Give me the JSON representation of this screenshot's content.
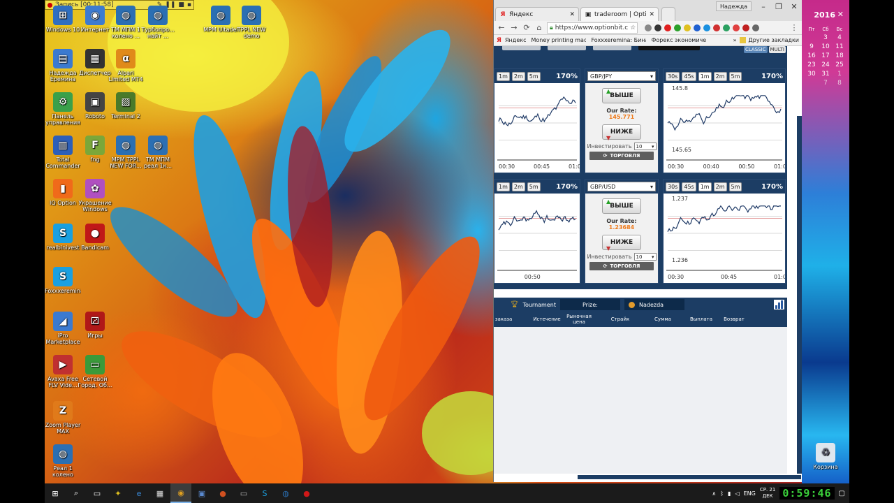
{
  "recording": {
    "label": "Запись [00:11:58]"
  },
  "desktop_icons": [
    {
      "label": "Windows 10",
      "color": "#2f6fc0",
      "glyph": "⊞",
      "col": 0,
      "row": 0
    },
    {
      "label": "Интернет",
      "color": "#3d7bd0",
      "glyph": "◉",
      "col": 1,
      "row": 0
    },
    {
      "label": "ТМ МПМ 1 колено ...",
      "color": "#2b6fb3",
      "glyph": "◍",
      "col": 2,
      "row": 0
    },
    {
      "label": "Турбопро... найт ...",
      "color": "#2b6fb3",
      "glyph": "◍",
      "col": 3,
      "row": 0
    },
    {
      "label": "МРМ Ultadel",
      "color": "#2b6fb3",
      "glyph": "◍",
      "col": 5,
      "row": 0
    },
    {
      "label": "ТРРL NEW demo",
      "color": "#2b6fb3",
      "glyph": "◍",
      "col": 6,
      "row": 0
    },
    {
      "label": "Надежда Еремина",
      "color": "#3b7ad0",
      "glyph": "▤",
      "col": 0,
      "row": 1
    },
    {
      "label": "Диспетчер",
      "color": "#333",
      "glyph": "▦",
      "col": 1,
      "row": 1
    },
    {
      "label": "Alpari Limited MT4",
      "color": "#e08a1a",
      "glyph": "α",
      "col": 2,
      "row": 1
    },
    {
      "label": "Панель управления",
      "color": "#3aa04a",
      "glyph": "⚙",
      "col": 0,
      "row": 2
    },
    {
      "label": "Roboto",
      "color": "#444",
      "glyph": "▣",
      "col": 1,
      "row": 2
    },
    {
      "label": "Terminal 2",
      "color": "#4a7a2a",
      "glyph": "▨",
      "col": 2,
      "row": 2
    },
    {
      "label": "Total Commander",
      "color": "#2d5fb8",
      "glyph": "▥",
      "col": 0,
      "row": 3
    },
    {
      "label": "fng",
      "color": "#7aa73a",
      "glyph": "F",
      "col": 1,
      "row": 3
    },
    {
      "label": "МРМ ТРРL NEW FOR...",
      "color": "#2b6fb3",
      "glyph": "◍",
      "col": 2,
      "row": 3
    },
    {
      "label": "ТМ МПМ реал 1к...",
      "color": "#2b6fb3",
      "glyph": "◍",
      "col": 3,
      "row": 3
    },
    {
      "label": "IQ Option",
      "color": "#f06a1a",
      "glyph": "▮",
      "col": 0,
      "row": 4
    },
    {
      "label": "Украшение Windows",
      "color": "#b050c0",
      "glyph": "✿",
      "col": 1,
      "row": 4
    },
    {
      "label": "realbinivest",
      "color": "#1aa0e0",
      "glyph": "S",
      "col": 0,
      "row": 5
    },
    {
      "label": "Bandicam",
      "color": "#c01818",
      "glyph": "●",
      "col": 1,
      "row": 5
    },
    {
      "label": "Foxxxeremina",
      "color": "#1aa0e0",
      "glyph": "S",
      "col": 0,
      "row": 6
    },
    {
      "label": "iPro Marketplace",
      "color": "#3b7ad0",
      "glyph": "◢",
      "col": 0,
      "row": 7
    },
    {
      "label": "Игры",
      "color": "#b01818",
      "glyph": "⚂",
      "col": 1,
      "row": 7
    },
    {
      "label": "Avaxa Free FLV Vide...",
      "color": "#c03030",
      "glyph": "▶",
      "col": 0,
      "row": 8
    },
    {
      "label": "Сетевой Город. Об...",
      "color": "#3a9a3a",
      "glyph": "▭",
      "col": 1,
      "row": 8
    },
    {
      "label": "Zoom Player MAX",
      "color": "#e07a1a",
      "glyph": "Z",
      "col": 0,
      "row": 9
    },
    {
      "label": "Реал 1 колено",
      "color": "#2b6fb3",
      "glyph": "◍",
      "col": 0,
      "row": 10
    }
  ],
  "recycle_bin": {
    "label": "Корзина"
  },
  "calendar": {
    "year": "2016",
    "close": "✕",
    "headers": [
      "Сб",
      "Вс"
    ],
    "rows": [
      [
        "3",
        "4"
      ],
      [
        "10",
        "11"
      ],
      [
        "17",
        "18"
      ],
      [
        "24",
        "25"
      ],
      [
        "31",
        "1"
      ],
      [
        "7",
        "8"
      ]
    ],
    "first_col": [
      "",
      "9",
      "16",
      "23",
      "30",
      ""
    ],
    "first_head": "Пт"
  },
  "browser": {
    "profile": "Надежда",
    "win_controls": [
      "–",
      "❐",
      "✕"
    ],
    "tabs": [
      {
        "title": "Яндекс",
        "icon": "Я",
        "icon_color": "#e02020"
      },
      {
        "title": "traderoom | OptionBit™",
        "icon": "▣",
        "icon_color": "#222"
      }
    ],
    "nav": [
      "←",
      "→",
      "⟳",
      "⌂"
    ],
    "url": "https://www.optionbit.c",
    "bookmarks": [
      {
        "label": "Яндекс",
        "color": "#e02020"
      },
      {
        "label": "Money printing mach",
        "color": "#888"
      },
      {
        "label": "Foxxxeremina: Бинар",
        "color": "#888"
      },
      {
        "label": "Форекс экономичес",
        "color": "#a04a10"
      }
    ],
    "bookmarks_more": "»",
    "other_bookmarks": "Другие закладки"
  },
  "trade": {
    "modes": [
      "CLASSIC",
      "MULTI"
    ],
    "panels": [
      {
        "asset": "GBP/JPY",
        "timeframes_left": [
          "1m",
          "2m",
          "5m"
        ],
        "timeframes_right": [
          "30s",
          "45s",
          "1m",
          "2m",
          "5m"
        ],
        "selected_right": "1m",
        "payout": "170%",
        "up_label": "ВЫШЕ",
        "down_label": "НИЖЕ",
        "rate_label": "Our Rate:",
        "rate": "145.771",
        "invest_label": "Инвестировать",
        "invest_value": "10",
        "trade_label": "ТОРГОВЛЯ",
        "left_x_labels": [
          "00:30",
          "00:45",
          "01:00"
        ],
        "right_x_labels": [
          "00:30",
          "00:40",
          "00:50",
          "01:00"
        ],
        "y_top": "145.8",
        "y_bottom": "145.65"
      },
      {
        "asset": "GBP/USD",
        "timeframes_left": [
          "1m",
          "2m",
          "5m"
        ],
        "timeframes_right": [
          "30s",
          "45s",
          "1m",
          "2m",
          "5m"
        ],
        "selected_right": "1m",
        "payout": "170%",
        "up_label": "ВЫШЕ",
        "down_label": "НИЖЕ",
        "rate_label": "Our Rate:",
        "rate": "1.23684",
        "invest_label": "Инвестировать",
        "invest_value": "10",
        "trade_label": "ТОРГОВЛЯ",
        "left_x_labels": [
          "00:50"
        ],
        "right_x_labels": [
          "00:30",
          "00:45",
          "01:00"
        ],
        "y_top": "1.237",
        "y_bottom": "1.236"
      }
    ]
  },
  "tournament": {
    "label": "Tournament",
    "prize_label": "Prize:",
    "user": "Nadezda"
  },
  "table_headers": [
    "заказа",
    "Истечение",
    "Рыночная цена",
    "Страйк",
    "Сумма",
    "Выплата",
    "Возврат"
  ],
  "taskbar": {
    "icons": [
      {
        "name": "start",
        "glyph": "⊞",
        "color": "#fff"
      },
      {
        "name": "search",
        "glyph": "⌕",
        "color": "#fff"
      },
      {
        "name": "task-view",
        "glyph": "▭",
        "color": "#fff"
      },
      {
        "name": "app-forex",
        "glyph": "✦",
        "color": "#e0c020"
      },
      {
        "name": "edge",
        "glyph": "e",
        "color": "#3a8ad8"
      },
      {
        "name": "calculator",
        "glyph": "▦",
        "color": "#ddd"
      },
      {
        "name": "chrome",
        "glyph": "◉",
        "color": "#e0a020"
      },
      {
        "name": "save",
        "glyph": "▣",
        "color": "#5a8ad0"
      },
      {
        "name": "app-orange",
        "glyph": "●",
        "color": "#d05020"
      },
      {
        "name": "app-window",
        "glyph": "▭",
        "color": "#bbb"
      },
      {
        "name": "skype",
        "glyph": "S",
        "color": "#1aa0e0"
      },
      {
        "name": "mt4",
        "glyph": "◍",
        "color": "#2b6fb3"
      },
      {
        "name": "bandicam",
        "glyph": "●",
        "color": "#d01818"
      }
    ],
    "tray_up": "∧",
    "lang": "ENG",
    "day": "СР. 21",
    "month": "ДЕК",
    "clock": "0:59:46",
    "notif": "▢"
  }
}
